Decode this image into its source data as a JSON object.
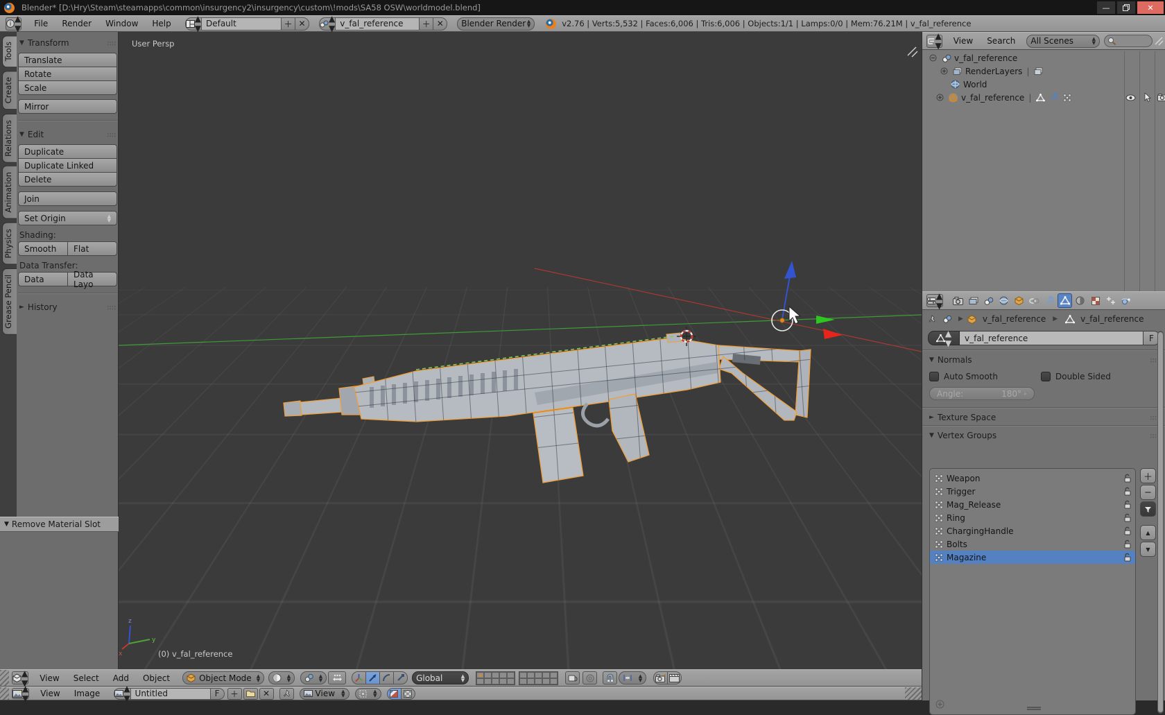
{
  "window": {
    "title": "Blender* [D:\\Hry\\Steam\\steamapps\\common\\insurgency2\\insurgency\\custom\\!mods\\SA58 OSW\\worldmodel.blend]"
  },
  "info_bar": {
    "menu_file": "File",
    "menu_render": "Render",
    "menu_window": "Window",
    "menu_help": "Help",
    "layout_name": "Default",
    "scene_name": "v_fal_reference",
    "engine": "Blender Render",
    "stats": "v2.76 | Verts:5,532 | Faces:6,006 | Tris:6,006 | Objects:1/1 | Lamps:0/0 | Mem:76.21M | v_fal_reference"
  },
  "tool_tabs": {
    "tools": "Tools",
    "create": "Create",
    "relations": "Relations",
    "animation": "Animation",
    "physics": "Physics",
    "grease_pencil": "Grease Pencil"
  },
  "tool_shelf": {
    "transform_title": "Transform",
    "translate": "Translate",
    "rotate": "Rotate",
    "scale": "Scale",
    "mirror": "Mirror",
    "edit_title": "Edit",
    "duplicate": "Duplicate",
    "duplicate_linked": "Duplicate Linked",
    "delete": "Delete",
    "join": "Join",
    "set_origin": "Set Origin",
    "shading_label": "Shading:",
    "smooth": "Smooth",
    "flat": "Flat",
    "data_transfer_label": "Data Transfer:",
    "data": "Data",
    "data_layout": "Data Layo",
    "history_title": "History",
    "operator_panel_title": "Remove Material Slot"
  },
  "viewport": {
    "view_label": "User Persp",
    "object_label": "(0) v_fal_reference",
    "axis_z": "z",
    "axis_y": "y",
    "axis_x": "x"
  },
  "outliner": {
    "menu_view": "View",
    "menu_search": "Search",
    "scenes_filter": "All Scenes",
    "scene": "v_fal_reference",
    "render_layers": "RenderLayers",
    "world": "World",
    "object": "v_fal_reference"
  },
  "properties": {
    "breadcrumb_object": "v_fal_reference",
    "breadcrumb_data": "v_fal_reference",
    "name_value": "v_fal_reference",
    "fake_user": "F",
    "normals_title": "Normals",
    "auto_smooth": "Auto Smooth",
    "double_sided": "Double Sided",
    "angle_label": "Angle:",
    "angle_value": "180°",
    "texture_space_title": "Texture Space",
    "vertex_groups_title": "Vertex Groups",
    "vg_0": "Weapon",
    "vg_1": "Trigger",
    "vg_2": "Mag_Release",
    "vg_3": "Ring",
    "vg_4": "ChargingHandle",
    "vg_5": "Bolts",
    "vg_6": "Magazine"
  },
  "view3d_header": {
    "menu_view": "View",
    "menu_select": "Select",
    "menu_add": "Add",
    "menu_object": "Object",
    "mode": "Object Mode",
    "orientation": "Global"
  },
  "image_header": {
    "menu_view": "View",
    "menu_image": "Image",
    "image_name": "Untitled",
    "fake_user": "F",
    "view_mode": "View"
  },
  "colors": {
    "selection": "#5381c1",
    "object_outline": "#f0a03a",
    "axis_x": "#c0392f",
    "axis_y": "#4ea433",
    "axis_z": "#3353cf"
  }
}
